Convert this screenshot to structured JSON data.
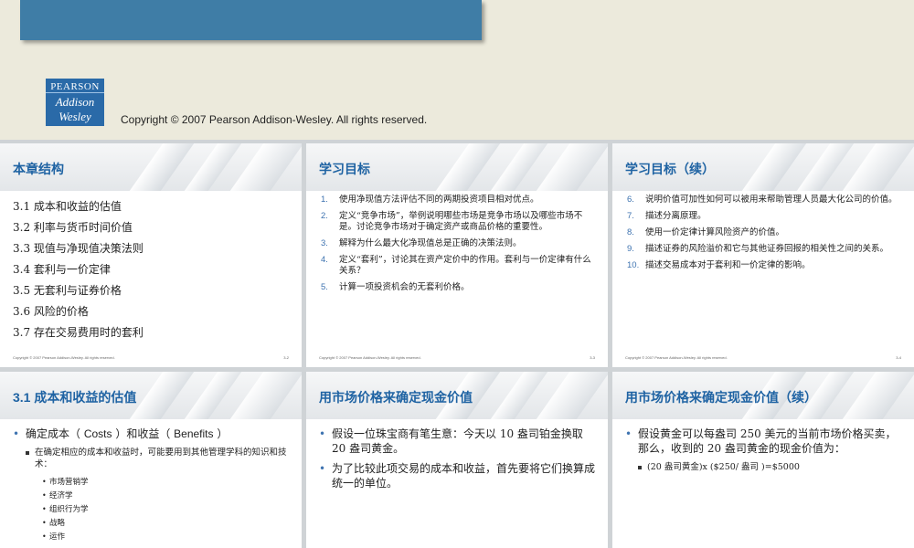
{
  "header": {
    "logo": {
      "line1": "PEARSON",
      "line2": "Addison",
      "line3": "Wesley",
      "bg": "#2a6aa8"
    },
    "copyright": "Copyright © 2007 Pearson Addison-Wesley. All rights reserved."
  },
  "slide_footer": "Copyright © 2007 Pearson Addison-Wesley. All rights reserved.",
  "slides": [
    {
      "title": "本章结构",
      "number": "3-2",
      "items": [
        "3.1  成本和收益的估值",
        "3.2  利率与货币时间价值",
        "3.3  现值与净现值决策法则",
        "3.4  套利与一价定律",
        "3.5  无套利与证券价格",
        "3.6  风险的价格",
        "3.7  存在交易费用时的套利"
      ]
    },
    {
      "title": "学习目标",
      "number": "3-3",
      "items": [
        {
          "num": "1.",
          "text": "使用净现值方法评估不同的两期投资项目相对优点。"
        },
        {
          "num": "2.",
          "text": "定义“竞争市场”，举例说明哪些市场是竞争市场以及哪些市场不是。讨论竞争市场对于确定资产或商品价格的重要性。"
        },
        {
          "num": "3.",
          "text": "解释为什么最大化净现值总是正确的决策法则。"
        },
        {
          "num": "4.",
          "text": "定义“套利”，讨论其在资产定价中的作用。套利与一价定律有什么关系？"
        },
        {
          "num": "5.",
          "text": "计算一项投资机会的无套利价格。"
        }
      ]
    },
    {
      "title": "学习目标（续）",
      "number": "3-4",
      "items": [
        {
          "num": "6.",
          "text": "说明价值可加性如何可以被用来帮助管理人员最大化公司的价值。"
        },
        {
          "num": "7.",
          "text": "描述分离原理。"
        },
        {
          "num": "8.",
          "text": "使用一价定律计算风险资产的价值。"
        },
        {
          "num": "9.",
          "text": "描述证券的风险溢价和它与其他证券回报的相关性之间的关系。"
        },
        {
          "num": "10.",
          "text": "描述交易成本对于套利和一价定律的影响。"
        }
      ]
    },
    {
      "title": "3.1  成本和收益的估值",
      "number": "",
      "bullet": {
        "pre": "确定成本（ ",
        "costs": "Costs",
        "mid": " ）和收益（ ",
        "benefits": "Benefits",
        "post": " ）"
      },
      "sub": "在确定相应的成本和收益时，可能要用到其他管理学科的知识和技术：",
      "subsub": [
        "市场营销学",
        "经济学",
        "组织行为学",
        "战略",
        "运作"
      ]
    },
    {
      "title": "用市场价格来确定现金价值",
      "number": "",
      "bullets": [
        "假设一位珠宝商有笔生意：今天以 10 盎司铂金换取 20 盎司黄金。",
        "为了比较此项交易的成本和收益，首先要将它们换算成统一的单位。"
      ]
    },
    {
      "title": "用市场价格来确定现金价值（续）",
      "number": "",
      "bullet": "假设黄金可以每盎司 250 美元的当前市场价格买卖，那么，收到的 20 盎司黄金的现金价值为：",
      "sub": "(20 盎司黄金)x ($250/ 盎司 )=$5000"
    }
  ]
}
